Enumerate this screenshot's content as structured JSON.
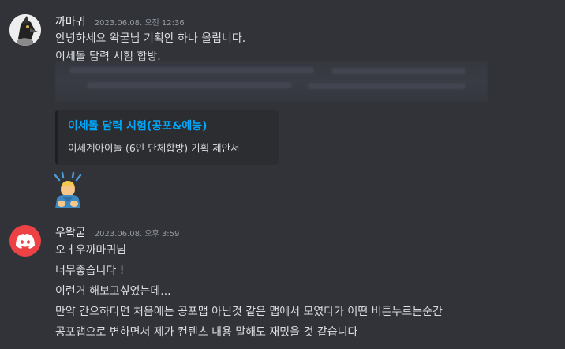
{
  "messages": [
    {
      "author": "까마귀",
      "timestamp": "2023.06.08. 오전 12:36",
      "lines": [
        "안녕하세요 왁굳님 기획안 하나 올립니다.",
        "이세돌 담력 시험 합방."
      ],
      "embed": {
        "title": "이세돌 담력 시험(공포&예능)",
        "description": "이세계아이돌 (6인 단체합방) 기획 제안서"
      },
      "emoji": "bowing-person-emoji"
    },
    {
      "author": "우왁굳",
      "timestamp": "2023.06.08. 오후 3:59",
      "lines": [
        "오ㅓ우까마귀님",
        "너무좋습니다 !",
        "이런거 해보고싶었는데...",
        "만약 간으하다면 처음에는 공포맵 아닌것 같은 맵에서 모였다가 어떤 버튼누르는순간",
        "공포맵으로 변하면서 제가 컨텐츠 내용 말해도 재밌을 것 같습니다"
      ]
    }
  ],
  "colors": {
    "background": "#313338",
    "link": "#00a8fc",
    "discord_avatar": "#ed4245"
  }
}
